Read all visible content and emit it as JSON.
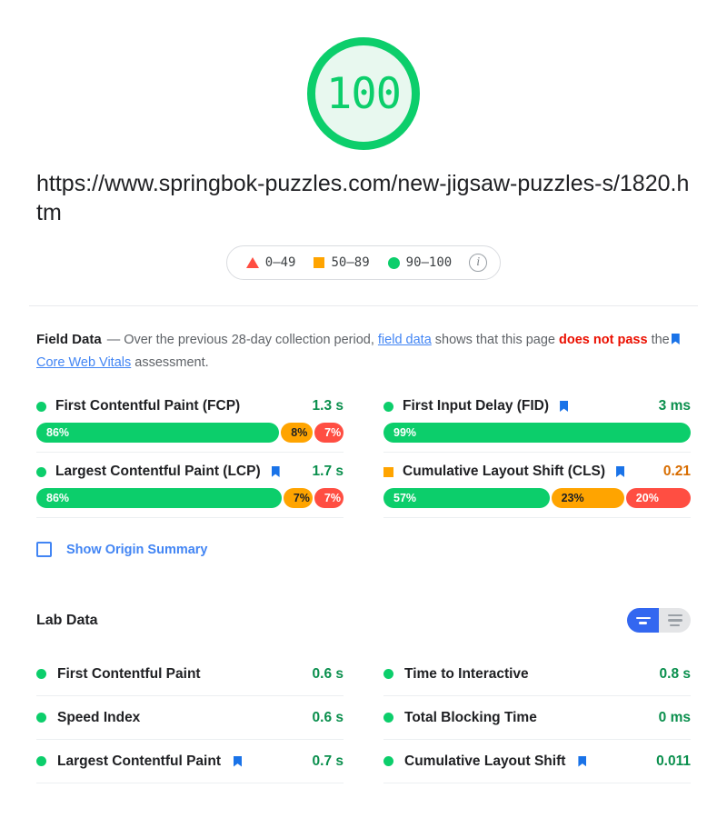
{
  "score": {
    "value": "100",
    "color": "#0cce6b"
  },
  "url": "https://www.springbok-puzzles.com/new-jigsaw-puzzles-s/1820.htm",
  "legend": {
    "items": [
      {
        "icon": "triangle-icon",
        "label": "0–49"
      },
      {
        "icon": "square-icon",
        "label": "50–89"
      },
      {
        "icon": "circle-icon",
        "label": "90–100"
      }
    ],
    "info_icon": "i"
  },
  "field_data": {
    "title": "Field Data",
    "dash": "—",
    "text_1": "Over the previous 28-day collection period,",
    "link_1": "field data",
    "text_2": "shows that this page",
    "fail_text": "does not pass",
    "text_3": "the",
    "link_2": "Core Web Vitals",
    "text_4": "assessment.",
    "metrics": [
      {
        "name": "First Contentful Paint (FCP)",
        "value": "1.3 s",
        "status": "good",
        "flag": false,
        "bar": [
          {
            "label": "86%",
            "pct": 86,
            "band": "good"
          },
          {
            "label": "8%",
            "pct": 8,
            "band": "avg"
          },
          {
            "label": "7%",
            "pct": 7,
            "band": "poor"
          }
        ]
      },
      {
        "name": "First Input Delay (FID)",
        "value": "3 ms",
        "status": "good",
        "flag": true,
        "bar": [
          {
            "label": "99%",
            "pct": 99,
            "band": "good"
          }
        ]
      },
      {
        "name": "Largest Contentful Paint (LCP)",
        "value": "1.7 s",
        "status": "good",
        "flag": true,
        "bar": [
          {
            "label": "86%",
            "pct": 86,
            "band": "good"
          },
          {
            "label": "7%",
            "pct": 7,
            "band": "avg"
          },
          {
            "label": "7%",
            "pct": 7,
            "band": "poor"
          }
        ]
      },
      {
        "name": "Cumulative Layout Shift (CLS)",
        "value": "0.21",
        "status": "avg",
        "flag": true,
        "bar": [
          {
            "label": "57%",
            "pct": 57,
            "band": "good"
          },
          {
            "label": "23%",
            "pct": 23,
            "band": "avg"
          },
          {
            "label": "20%",
            "pct": 20,
            "band": "poor"
          }
        ]
      }
    ],
    "origin_summary_label": "Show Origin Summary",
    "origin_summary_checked": false
  },
  "lab_data": {
    "title": "Lab Data",
    "view_toggle": {
      "condensed_active": true,
      "condensed_name": "condensed-view",
      "expanded_name": "expanded-view"
    },
    "metrics_left": [
      {
        "name": "First Contentful Paint",
        "value": "0.6 s",
        "flag": false
      },
      {
        "name": "Speed Index",
        "value": "0.6 s",
        "flag": false
      },
      {
        "name": "Largest Contentful Paint",
        "value": "0.7 s",
        "flag": true
      }
    ],
    "metrics_right": [
      {
        "name": "Time to Interactive",
        "value": "0.8 s",
        "flag": false
      },
      {
        "name": "Total Blocking Time",
        "value": "0 ms",
        "flag": false
      },
      {
        "name": "Cumulative Layout Shift",
        "value": "0.011",
        "flag": true
      }
    ]
  }
}
